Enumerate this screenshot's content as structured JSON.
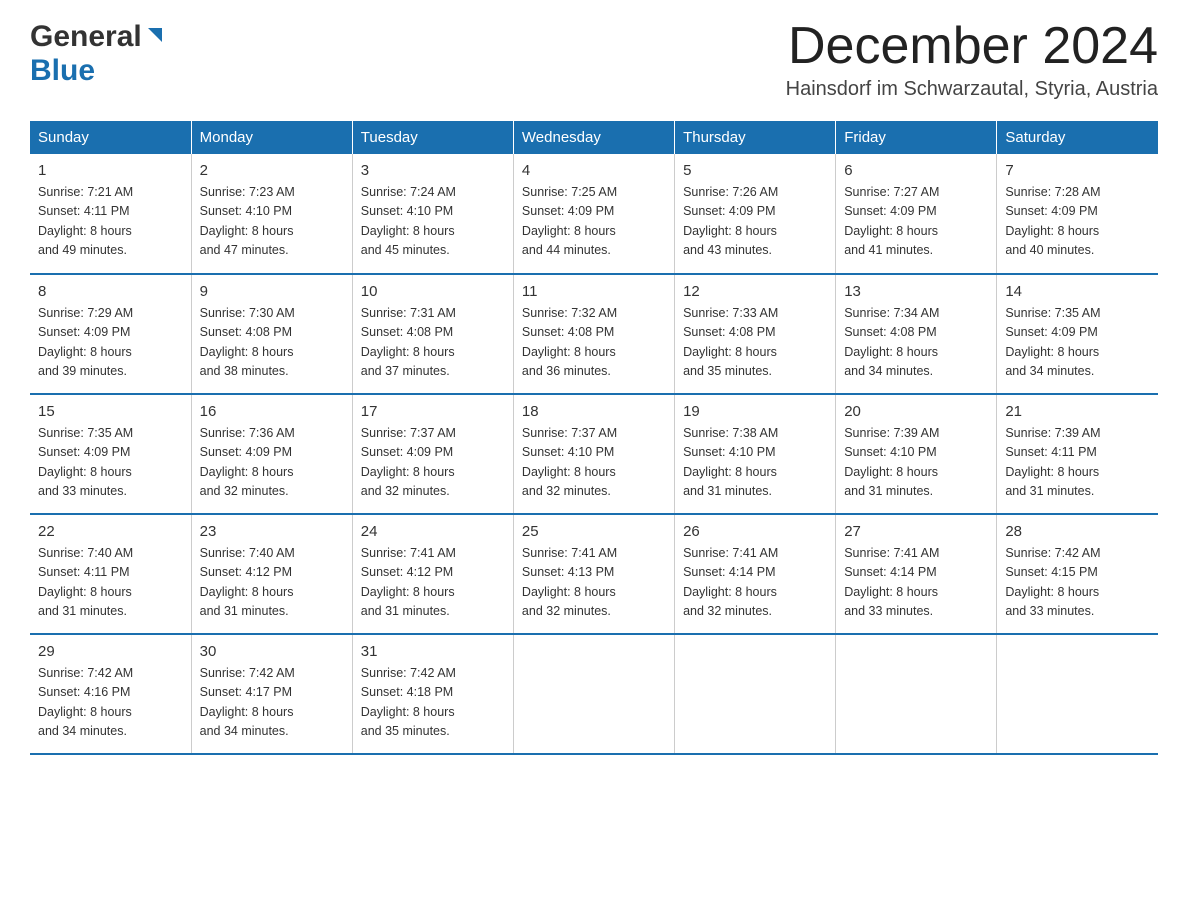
{
  "header": {
    "logo_general": "General",
    "logo_blue": "Blue",
    "month_title": "December 2024",
    "location": "Hainsdorf im Schwarzautal, Styria, Austria"
  },
  "weekdays": [
    "Sunday",
    "Monday",
    "Tuesday",
    "Wednesday",
    "Thursday",
    "Friday",
    "Saturday"
  ],
  "weeks": [
    [
      {
        "day": "1",
        "sunrise": "Sunrise: 7:21 AM",
        "sunset": "Sunset: 4:11 PM",
        "daylight": "Daylight: 8 hours",
        "minutes": "and 49 minutes."
      },
      {
        "day": "2",
        "sunrise": "Sunrise: 7:23 AM",
        "sunset": "Sunset: 4:10 PM",
        "daylight": "Daylight: 8 hours",
        "minutes": "and 47 minutes."
      },
      {
        "day": "3",
        "sunrise": "Sunrise: 7:24 AM",
        "sunset": "Sunset: 4:10 PM",
        "daylight": "Daylight: 8 hours",
        "minutes": "and 45 minutes."
      },
      {
        "day": "4",
        "sunrise": "Sunrise: 7:25 AM",
        "sunset": "Sunset: 4:09 PM",
        "daylight": "Daylight: 8 hours",
        "minutes": "and 44 minutes."
      },
      {
        "day": "5",
        "sunrise": "Sunrise: 7:26 AM",
        "sunset": "Sunset: 4:09 PM",
        "daylight": "Daylight: 8 hours",
        "minutes": "and 43 minutes."
      },
      {
        "day": "6",
        "sunrise": "Sunrise: 7:27 AM",
        "sunset": "Sunset: 4:09 PM",
        "daylight": "Daylight: 8 hours",
        "minutes": "and 41 minutes."
      },
      {
        "day": "7",
        "sunrise": "Sunrise: 7:28 AM",
        "sunset": "Sunset: 4:09 PM",
        "daylight": "Daylight: 8 hours",
        "minutes": "and 40 minutes."
      }
    ],
    [
      {
        "day": "8",
        "sunrise": "Sunrise: 7:29 AM",
        "sunset": "Sunset: 4:09 PM",
        "daylight": "Daylight: 8 hours",
        "minutes": "and 39 minutes."
      },
      {
        "day": "9",
        "sunrise": "Sunrise: 7:30 AM",
        "sunset": "Sunset: 4:08 PM",
        "daylight": "Daylight: 8 hours",
        "minutes": "and 38 minutes."
      },
      {
        "day": "10",
        "sunrise": "Sunrise: 7:31 AM",
        "sunset": "Sunset: 4:08 PM",
        "daylight": "Daylight: 8 hours",
        "minutes": "and 37 minutes."
      },
      {
        "day": "11",
        "sunrise": "Sunrise: 7:32 AM",
        "sunset": "Sunset: 4:08 PM",
        "daylight": "Daylight: 8 hours",
        "minutes": "and 36 minutes."
      },
      {
        "day": "12",
        "sunrise": "Sunrise: 7:33 AM",
        "sunset": "Sunset: 4:08 PM",
        "daylight": "Daylight: 8 hours",
        "minutes": "and 35 minutes."
      },
      {
        "day": "13",
        "sunrise": "Sunrise: 7:34 AM",
        "sunset": "Sunset: 4:08 PM",
        "daylight": "Daylight: 8 hours",
        "minutes": "and 34 minutes."
      },
      {
        "day": "14",
        "sunrise": "Sunrise: 7:35 AM",
        "sunset": "Sunset: 4:09 PM",
        "daylight": "Daylight: 8 hours",
        "minutes": "and 34 minutes."
      }
    ],
    [
      {
        "day": "15",
        "sunrise": "Sunrise: 7:35 AM",
        "sunset": "Sunset: 4:09 PM",
        "daylight": "Daylight: 8 hours",
        "minutes": "and 33 minutes."
      },
      {
        "day": "16",
        "sunrise": "Sunrise: 7:36 AM",
        "sunset": "Sunset: 4:09 PM",
        "daylight": "Daylight: 8 hours",
        "minutes": "and 32 minutes."
      },
      {
        "day": "17",
        "sunrise": "Sunrise: 7:37 AM",
        "sunset": "Sunset: 4:09 PM",
        "daylight": "Daylight: 8 hours",
        "minutes": "and 32 minutes."
      },
      {
        "day": "18",
        "sunrise": "Sunrise: 7:37 AM",
        "sunset": "Sunset: 4:10 PM",
        "daylight": "Daylight: 8 hours",
        "minutes": "and 32 minutes."
      },
      {
        "day": "19",
        "sunrise": "Sunrise: 7:38 AM",
        "sunset": "Sunset: 4:10 PM",
        "daylight": "Daylight: 8 hours",
        "minutes": "and 31 minutes."
      },
      {
        "day": "20",
        "sunrise": "Sunrise: 7:39 AM",
        "sunset": "Sunset: 4:10 PM",
        "daylight": "Daylight: 8 hours",
        "minutes": "and 31 minutes."
      },
      {
        "day": "21",
        "sunrise": "Sunrise: 7:39 AM",
        "sunset": "Sunset: 4:11 PM",
        "daylight": "Daylight: 8 hours",
        "minutes": "and 31 minutes."
      }
    ],
    [
      {
        "day": "22",
        "sunrise": "Sunrise: 7:40 AM",
        "sunset": "Sunset: 4:11 PM",
        "daylight": "Daylight: 8 hours",
        "minutes": "and 31 minutes."
      },
      {
        "day": "23",
        "sunrise": "Sunrise: 7:40 AM",
        "sunset": "Sunset: 4:12 PM",
        "daylight": "Daylight: 8 hours",
        "minutes": "and 31 minutes."
      },
      {
        "day": "24",
        "sunrise": "Sunrise: 7:41 AM",
        "sunset": "Sunset: 4:12 PM",
        "daylight": "Daylight: 8 hours",
        "minutes": "and 31 minutes."
      },
      {
        "day": "25",
        "sunrise": "Sunrise: 7:41 AM",
        "sunset": "Sunset: 4:13 PM",
        "daylight": "Daylight: 8 hours",
        "minutes": "and 32 minutes."
      },
      {
        "day": "26",
        "sunrise": "Sunrise: 7:41 AM",
        "sunset": "Sunset: 4:14 PM",
        "daylight": "Daylight: 8 hours",
        "minutes": "and 32 minutes."
      },
      {
        "day": "27",
        "sunrise": "Sunrise: 7:41 AM",
        "sunset": "Sunset: 4:14 PM",
        "daylight": "Daylight: 8 hours",
        "minutes": "and 33 minutes."
      },
      {
        "day": "28",
        "sunrise": "Sunrise: 7:42 AM",
        "sunset": "Sunset: 4:15 PM",
        "daylight": "Daylight: 8 hours",
        "minutes": "and 33 minutes."
      }
    ],
    [
      {
        "day": "29",
        "sunrise": "Sunrise: 7:42 AM",
        "sunset": "Sunset: 4:16 PM",
        "daylight": "Daylight: 8 hours",
        "minutes": "and 34 minutes."
      },
      {
        "day": "30",
        "sunrise": "Sunrise: 7:42 AM",
        "sunset": "Sunset: 4:17 PM",
        "daylight": "Daylight: 8 hours",
        "minutes": "and 34 minutes."
      },
      {
        "day": "31",
        "sunrise": "Sunrise: 7:42 AM",
        "sunset": "Sunset: 4:18 PM",
        "daylight": "Daylight: 8 hours",
        "minutes": "and 35 minutes."
      },
      {
        "day": "",
        "sunrise": "",
        "sunset": "",
        "daylight": "",
        "minutes": ""
      },
      {
        "day": "",
        "sunrise": "",
        "sunset": "",
        "daylight": "",
        "minutes": ""
      },
      {
        "day": "",
        "sunrise": "",
        "sunset": "",
        "daylight": "",
        "minutes": ""
      },
      {
        "day": "",
        "sunrise": "",
        "sunset": "",
        "daylight": "",
        "minutes": ""
      }
    ]
  ]
}
